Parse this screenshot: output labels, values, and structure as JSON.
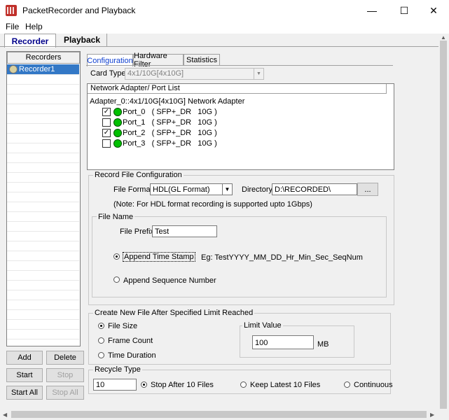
{
  "window": {
    "title": "PacketRecorder and Playback",
    "minimize_glyph": "—",
    "maximize_glyph": "☐",
    "close_glyph": "✕"
  },
  "menu": {
    "file": "File",
    "help": "Help"
  },
  "main_tabs": {
    "recorder": "Recorder",
    "playback": "Playback"
  },
  "recorders": {
    "header": "Recorders",
    "items": [
      "Recorder1"
    ]
  },
  "buttons": {
    "add": "Add",
    "delete": "Delete",
    "start": "Start",
    "stop": "Stop",
    "start_all": "Start All",
    "stop_all": "Stop All"
  },
  "sub_tabs": {
    "configuration": "Configuration",
    "hardware_filter": "Hardware Filter",
    "statistics": "Statistics"
  },
  "card_type": {
    "label": "Card Type",
    "value": "4x1/10G[4x10G]"
  },
  "adapter_list": {
    "header": "Network Adapter/ Port List",
    "adapter": "Adapter_0::4x1/10G[4x10G] Network Adapter",
    "ports": [
      {
        "label": "Port_0   ( SFP+_DR   10G )",
        "checked": true
      },
      {
        "label": "Port_1   ( SFP+_DR   10G )",
        "checked": false
      },
      {
        "label": "Port_2   ( SFP+_DR   10G )",
        "checked": true
      },
      {
        "label": "Port_3   ( SFP+_DR   10G )",
        "checked": false
      }
    ]
  },
  "record_config": {
    "title": "Record File Configuration",
    "file_format_label": "File Format",
    "file_format_value": "HDL(GL Format)",
    "directory_label": "Directory",
    "directory_value": "D:\\RECORDED\\",
    "browse_label": "...",
    "note": "(Note: For HDL format recording is supported upto 1Gbps)",
    "file_name": {
      "title": "File Name",
      "prefix_label": "File Prefix",
      "prefix_value": "Test",
      "append_timestamp": "Append Time Stamp",
      "example": "Eg: TestYYYY_MM_DD_Hr_Min_Sec_SeqNum",
      "append_sequence": "Append Sequence Number",
      "selected": "timestamp"
    }
  },
  "new_file_limit": {
    "title": "Create New File After Specified Limit Reached",
    "file_size": "File Size",
    "frame_count": "Frame Count",
    "time_duration": "Time Duration",
    "selected": "file_size",
    "limit_title": "Limit Value",
    "limit_value": "100",
    "limit_unit": "MB"
  },
  "recycle": {
    "title": "Recycle Type",
    "value": "10",
    "stop_after": "Stop After 10 Files",
    "keep_latest": "Keep Latest 10 Files",
    "continuous": "Continuous",
    "selected": "stop_after"
  },
  "colors": {
    "selection": "#3378c6",
    "active_tab_text": "#00008b",
    "port_status": "#00c000"
  }
}
